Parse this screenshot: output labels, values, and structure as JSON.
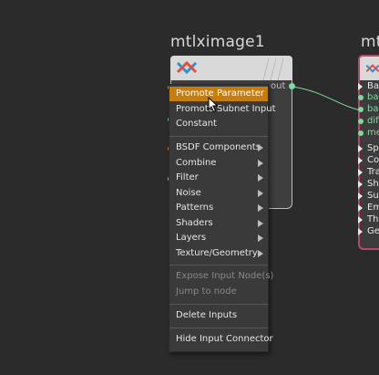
{
  "colors": {
    "background": "#2b2b2b",
    "menu_background": "#3a3a3a",
    "highlight": "#c77d0c",
    "port_green": "#7fd99a",
    "node_border_selected": "#b8486a"
  },
  "node1": {
    "title": "mtlximage1",
    "icon": "materialx-logo-icon",
    "output_label": "out"
  },
  "node2": {
    "title": "mt",
    "icon": "materialx-logo-icon",
    "inputs": [
      "Bas",
      "bas",
      "bas",
      "diff",
      "me",
      "Spe",
      "Coa",
      "Tra",
      "She",
      "Sub",
      "Em",
      "Thi",
      "Geo"
    ]
  },
  "context_menu": {
    "items": [
      {
        "label": "Promote Parameter",
        "state": "highlighted"
      },
      {
        "label": "Promote Subnet Input",
        "state": "normal"
      },
      {
        "label": "Constant",
        "state": "normal"
      },
      {
        "label": "BSDF Components",
        "state": "submenu"
      },
      {
        "label": "Combine",
        "state": "submenu"
      },
      {
        "label": "Filter",
        "state": "submenu"
      },
      {
        "label": "Noise",
        "state": "submenu"
      },
      {
        "label": "Patterns",
        "state": "submenu"
      },
      {
        "label": "Shaders",
        "state": "submenu"
      },
      {
        "label": "Layers",
        "state": "submenu"
      },
      {
        "label": "Texture/Geometry",
        "state": "submenu"
      },
      {
        "label": "Expose Input Node(s)",
        "state": "disabled"
      },
      {
        "label": "Jump to node",
        "state": "disabled"
      },
      {
        "label": "Delete Inputs",
        "state": "normal"
      },
      {
        "label": "Hide Input Connector",
        "state": "normal"
      }
    ]
  }
}
